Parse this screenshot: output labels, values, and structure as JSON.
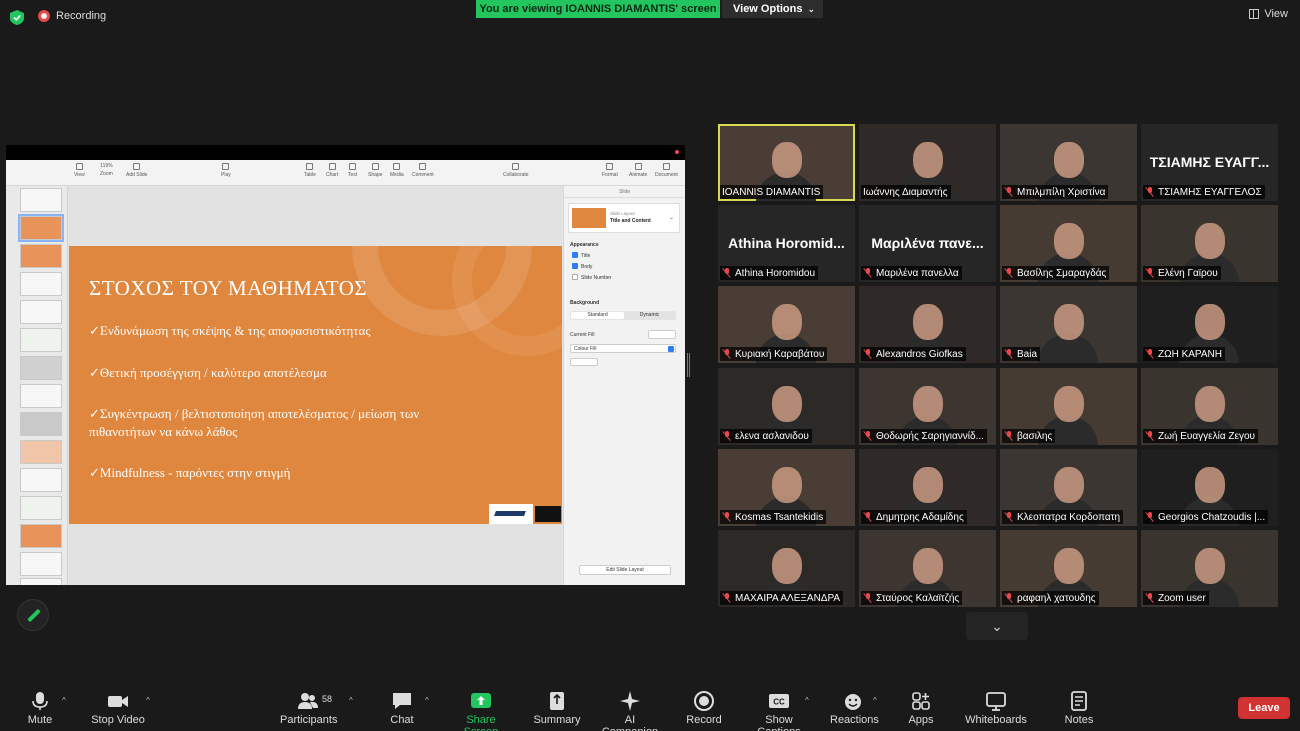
{
  "topbar": {
    "recording_label": "Recording",
    "viewing_banner": "You are viewing IOANNIS DIAMANTIS' screen",
    "view_options_label": "View Options",
    "view_label": "View"
  },
  "shared_screen": {
    "toolbar": [
      "View",
      "Zoom",
      "Add Slide",
      "Play",
      "Table",
      "Chart",
      "Text",
      "Shape",
      "Media",
      "Comment",
      "Collaborate",
      "Format",
      "Animate",
      "Document"
    ],
    "zoom_value": "119%",
    "slide": {
      "title": "ΣΤΟΧΟΣ ΤΟΥ ΜΑΘΗΜΑΤΟΣ",
      "bullets": [
        "✓Ενδυνάμωση της σκέψης & της αποφασιστικότητας",
        "✓Θετική προσέγγιση / καλύτερο αποτέλεσμα",
        "✓Συγκέντρωση / βελτιστοποίηση αποτελέσματος / μείωση των πιθανοτήτων να κάνω λάθος",
        "✓Mindfulness - παρόντες στην στιγμή"
      ]
    },
    "panel": {
      "tab": "Slide",
      "layout_caption": "Slide Layout",
      "layout_name": "Title and Content",
      "appearance": "Appearance",
      "checks": [
        "Title",
        "Body",
        "Slide Number"
      ],
      "background": "Background",
      "bg_standard": "Standard",
      "bg_dynamic": "Dynamic",
      "current_fill": "Current Fill",
      "colour_fill": "Colour Fill",
      "edit_layout": "Edit Slide Layout"
    }
  },
  "participants": [
    {
      "name": "IOANNIS DIAMANTIS",
      "video": true,
      "muted": false,
      "active": true
    },
    {
      "name": "Ιωάννης Διαμαντής",
      "video": true,
      "muted": false
    },
    {
      "name": "Μπιλμπίλη Χριστίνα",
      "video": true,
      "muted": true
    },
    {
      "name": "ΤΣΙΑΜΗΣ ΕΥΑΓΓΕΛΟΣ",
      "big": "ΤΣΙΑΜΗΣ ΕΥΑΓΓ...",
      "video": false,
      "muted": true
    },
    {
      "name": "Athina Horomidou",
      "big": "Athina Horomid...",
      "video": false,
      "muted": true
    },
    {
      "name": "Μαριλένα πανελλα",
      "big": "Μαριλένα πανε...",
      "video": false,
      "muted": true
    },
    {
      "name": "Βασίλης Σμαραγδάς",
      "video": true,
      "muted": true
    },
    {
      "name": "Ελένη Γαϊρου",
      "video": true,
      "muted": true
    },
    {
      "name": "Κυριακή Καραβάτου",
      "video": true,
      "muted": true
    },
    {
      "name": "Alexandros Giofkas",
      "video": true,
      "muted": true
    },
    {
      "name": "Baia",
      "video": true,
      "muted": true
    },
    {
      "name": "ΖΩΗ ΚΑΡΑΝΗ",
      "video": true,
      "muted": true
    },
    {
      "name": "ελενα ασλανιδου",
      "video": true,
      "muted": true
    },
    {
      "name": "Θοδωρής Σαρηγιαννίδ...",
      "video": true,
      "muted": true
    },
    {
      "name": "βασιλης",
      "video": true,
      "muted": true
    },
    {
      "name": "Ζωή Ευαγγελία Ζεγου",
      "video": true,
      "muted": true
    },
    {
      "name": "Kosmas Tsantekidis",
      "video": true,
      "muted": true
    },
    {
      "name": "Δημητρης Αδαμίδης",
      "video": true,
      "muted": true
    },
    {
      "name": "Κλεοπατρα Κορδοπατη",
      "video": true,
      "muted": true
    },
    {
      "name": "Georgios Chatzoudis |...",
      "video": true,
      "muted": true
    },
    {
      "name": "ΜΑΧΑΙΡΑ ΑΛΕΞΑΝΔΡΑ",
      "video": true,
      "muted": true
    },
    {
      "name": "Σταύρος Καλαϊτζής",
      "video": true,
      "muted": true
    },
    {
      "name": "ραφαηλ χατουδης",
      "video": true,
      "muted": true
    },
    {
      "name": "Zoom user",
      "video": true,
      "muted": true
    }
  ],
  "toolbar": {
    "mute": "Mute",
    "stop_video": "Stop Video",
    "participants": "Participants",
    "participants_count": "58",
    "chat": "Chat",
    "share_screen": "Share Screen",
    "summary": "Summary",
    "ai_companion": "AI Companion",
    "record": "Record",
    "show_captions": "Show Captions",
    "reactions": "Reactions",
    "apps": "Apps",
    "whiteboards": "Whiteboards",
    "notes": "Notes",
    "leave": "Leave"
  },
  "colors": {
    "accent_green": "#22c55e",
    "slide_orange": "#e0873f",
    "leave_red": "#d13232",
    "active_speaker": "#d9d94f"
  }
}
